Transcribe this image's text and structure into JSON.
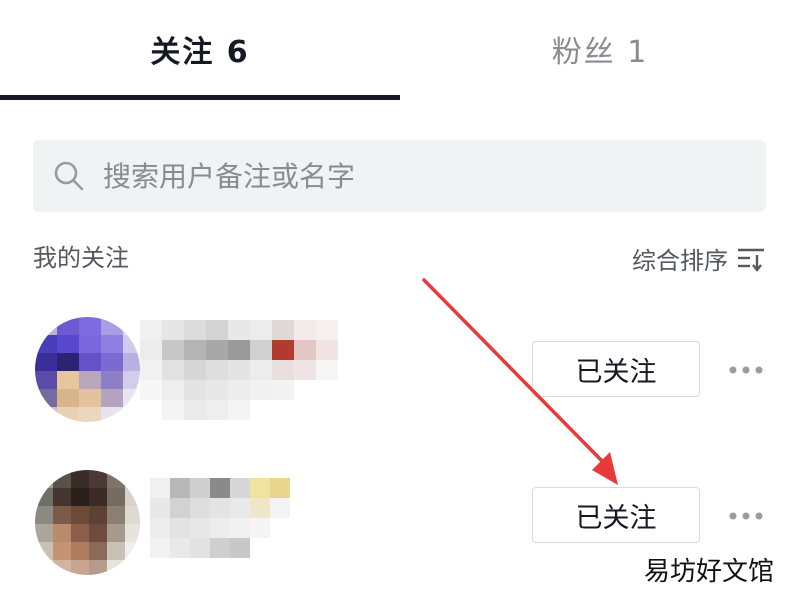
{
  "tabs": [
    {
      "label": "关注 6",
      "active": true
    },
    {
      "label": "粉丝 1",
      "active": false
    }
  ],
  "search": {
    "placeholder": "搜索用户备注或名字",
    "value": "",
    "icon": "search-icon"
  },
  "section": {
    "title": "我的关注",
    "sort_label": "综合排序",
    "sort_icon": "sort-icon"
  },
  "following_list": [
    {
      "button_label": "已关注",
      "more_icon": "more-dots-icon"
    },
    {
      "button_label": "已关注",
      "more_icon": "more-dots-icon"
    }
  ],
  "annotation": {
    "type": "red-arrow",
    "color": "#e83a3a",
    "points_to": "following_list.1.button_label"
  },
  "watermark": "易坊好文馆",
  "colors": {
    "text": "#161823",
    "secondary": "#8a8b91",
    "search_bg": "#f1f2f4",
    "arrow": "#e83a3a"
  }
}
